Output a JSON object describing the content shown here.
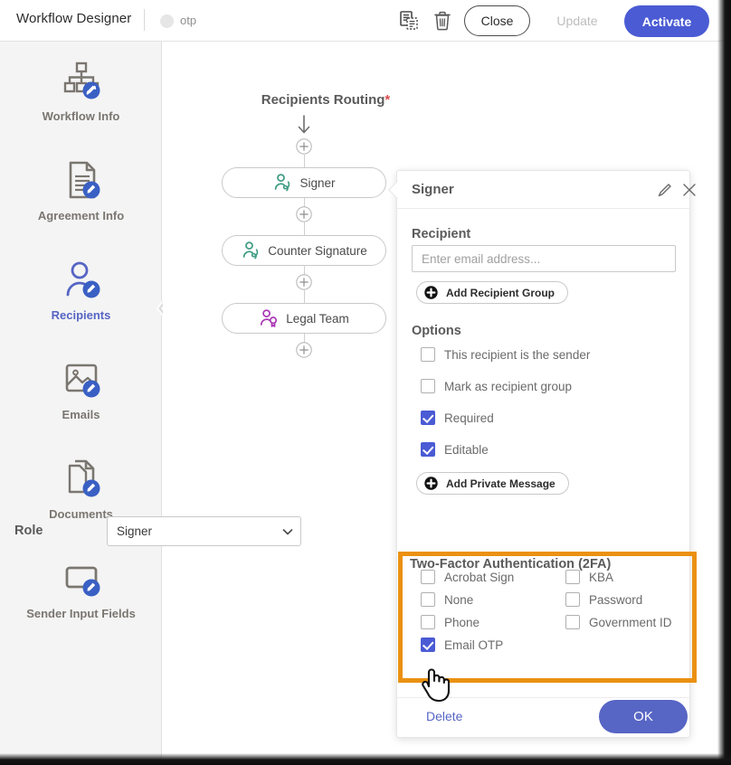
{
  "colors": {
    "accent_blue": "#4a5bd4",
    "button_blue": "#5765c4",
    "highlight_orange": "#eb9112",
    "sidebar_bg": "#f4f4f4",
    "required_red": "#d94b4b",
    "signer_green": "#3e9b82",
    "legal_purple": "#a836b4"
  },
  "topbar": {
    "app_title": "Workflow Designer",
    "workflow_name": "otp",
    "copy_icon": "copy-document-icon",
    "trash_icon": "trash-icon",
    "close_label": "Close",
    "update_label": "Update",
    "activate_label": "Activate"
  },
  "sidebar": {
    "collapse_icon": "chevron-left-icon",
    "items": [
      {
        "label": "Workflow Info",
        "icon": "workflow-info-icon",
        "active": false
      },
      {
        "label": "Agreement Info",
        "icon": "agreement-info-icon",
        "active": false
      },
      {
        "label": "Recipients",
        "icon": "recipients-icon",
        "active": true
      },
      {
        "label": "Emails",
        "icon": "emails-icon",
        "active": false
      },
      {
        "label": "Documents",
        "icon": "documents-icon",
        "active": false
      },
      {
        "label": "Sender Input Fields",
        "icon": "sender-input-fields-icon",
        "active": false
      }
    ]
  },
  "canvas": {
    "routing_title": "Recipients Routing",
    "routing_required_marker": "*",
    "add_icon": "plus-circle-icon",
    "nodes": [
      {
        "label": "Signer",
        "icon": "signer-icon"
      },
      {
        "label": "Counter Signature",
        "icon": "counter-signature-icon"
      },
      {
        "label": "Legal Team",
        "icon": "legal-team-icon"
      }
    ]
  },
  "panel": {
    "title": "Signer",
    "edit_icon": "pencil-icon",
    "close_icon": "close-x-icon",
    "recipient": {
      "section_title": "Recipient",
      "email_value": "",
      "email_placeholder": "Enter email address...",
      "add_group_label": "Add Recipient Group",
      "add_group_icon": "plus-filled-icon"
    },
    "options": {
      "section_title": "Options",
      "items": [
        {
          "label": "This recipient is the sender",
          "checked": false
        },
        {
          "label": "Mark as recipient group",
          "checked": false
        },
        {
          "label": "Required",
          "checked": true
        },
        {
          "label": "Editable",
          "checked": true
        }
      ],
      "add_private_message_label": "Add Private Message",
      "add_private_message_icon": "plus-filled-icon"
    },
    "role": {
      "label": "Role",
      "selected": "Signer",
      "chevron_icon": "chevron-down-icon"
    },
    "twofa": {
      "section_title": "Two-Factor Authentication (2FA)",
      "left_column": [
        {
          "label": "Acrobat Sign",
          "checked": false
        },
        {
          "label": "None",
          "checked": false
        },
        {
          "label": "Phone",
          "checked": false
        },
        {
          "label": "Email OTP",
          "checked": true
        }
      ],
      "right_column": [
        {
          "label": "KBA",
          "checked": false
        },
        {
          "label": "Password",
          "checked": false
        },
        {
          "label": "Government ID",
          "checked": false
        }
      ]
    },
    "footer": {
      "delete_label": "Delete",
      "ok_label": "OK"
    }
  },
  "cursor": {
    "icon": "pointing-hand-cursor"
  }
}
